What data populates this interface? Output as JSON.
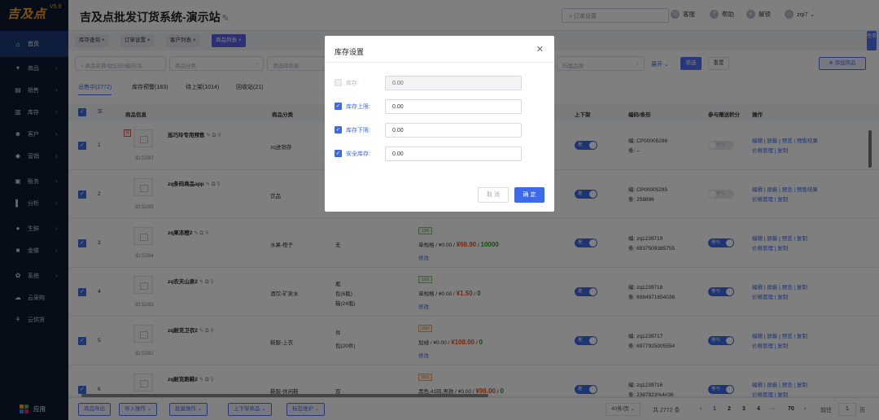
{
  "sidebar": {
    "logo": "吉及点",
    "version": "V5.9",
    "items": [
      {
        "label": "首页",
        "icon": "home-icon",
        "glyph": "⌂"
      },
      {
        "label": "商品",
        "icon": "cart-icon",
        "glyph": "▾"
      },
      {
        "label": "销售",
        "icon": "sales-icon",
        "glyph": "▤"
      },
      {
        "label": "库存",
        "icon": "inventory-icon",
        "glyph": "▥"
      },
      {
        "label": "客户",
        "icon": "customer-icon",
        "glyph": "☻"
      },
      {
        "label": "营销",
        "icon": "marketing-icon",
        "glyph": "◆"
      },
      {
        "label": "账务",
        "icon": "finance-icon",
        "glyph": "▣"
      },
      {
        "label": "分析",
        "icon": "analysis-icon",
        "glyph": "▌"
      },
      {
        "label": "生鲜",
        "icon": "fresh-icon",
        "glyph": "●"
      },
      {
        "label": "金蝶",
        "icon": "kingdee-icon",
        "glyph": "■"
      },
      {
        "label": "系统",
        "icon": "system-icon",
        "glyph": "✿"
      },
      {
        "label": "云采购",
        "icon": "cloud-purchase-icon",
        "glyph": "☁"
      },
      {
        "label": "云供货",
        "icon": "cloud-supply-icon",
        "glyph": "⚘"
      }
    ],
    "app_label": "应用"
  },
  "header": {
    "title": "吉及点批发订货系统-演示站",
    "search_placeholder": "订单设置",
    "service": "客服",
    "help": "帮助",
    "unlock": "解锁",
    "user": "zqi7"
  },
  "tabs": [
    "库存查询",
    "订单设置",
    "客户列表",
    "商品列表"
  ],
  "right_tab": "任务",
  "filters": {
    "keyword_placeholder": "商品名称/助记码/编码/关",
    "category_placeholder": "商品分类",
    "supplier_placeholder": "请选择商家",
    "brand_placeholder": "所属品牌",
    "expand": "展开",
    "filter_btn": "筛选",
    "reset_btn": "重置",
    "add_btn": "添加商品"
  },
  "status_tabs": [
    "出售中(2772)",
    "库存预警(183)",
    "待上架(1014)",
    "回收站(21)"
  ],
  "table": {
    "headers": {
      "info": "商品信息",
      "category": "商品分类",
      "shelf": "上下架",
      "code": "编码/条形",
      "points": "参与赠送积分",
      "ops": "操作"
    },
    "rows": [
      {
        "idx": "1",
        "name": "巡巧玲专用预售",
        "id": "ID:5287",
        "category": "zq进销存",
        "unit": "",
        "spec": "",
        "code": "编: CP00005286",
        "barcode": "条: --",
        "shelf": "是",
        "points": "不参与",
        "ops1": "编辑 | 屏蔽 | 预览 | 预售结果",
        "ops2": "价格管理 | 复制"
      },
      {
        "idx": "2",
        "name": "zq条码商品app",
        "id": "ID:5285",
        "category": "饮品",
        "unit": "",
        "spec": "",
        "code": "编: CP00005285",
        "barcode": "条: 258896",
        "shelf": "是",
        "points": "不参与",
        "ops1": "编辑 | 屏蔽 | 预览 | 预售结果",
        "ops2": "价格管理 | 复制"
      },
      {
        "idx": "3",
        "name": "zq果冻橙2",
        "id": "ID:5284",
        "category": "水果-橙子",
        "unit": "无",
        "stock": "199",
        "spec": "单规格",
        "price0": "¥0.00",
        "price": "¥68.90",
        "qty": "10000",
        "edit": "修改",
        "code": "编: zq1239719",
        "barcode": "条: 6937509385755",
        "shelf": "是",
        "points": "参与",
        "ops1": "编辑 | 屏蔽 | 预览 | 复制",
        "ops2": "价格管理 | 复制"
      },
      {
        "idx": "4",
        "name": "zq农夫山泉2",
        "id": "ID:5283",
        "category": "酒饮-矿泉水",
        "unit": "瓶",
        "unit2": "包(6瓶)",
        "unit3": "箱(24瓶)",
        "stock": "199",
        "spec": "单规格",
        "price0": "¥0.00",
        "price": "¥1.50",
        "qty": "0",
        "edit": "修改",
        "code": "编: zq1239718",
        "barcode": "条: 6984971654036",
        "shelf": "是",
        "points": "参与",
        "ops1": "编辑 | 屏蔽 | 预览 | 复制",
        "ops2": "价格管理 | 复制"
      },
      {
        "idx": "5",
        "name": "zq耐克卫衣2",
        "id": "ID:5282",
        "category": "鞋服-上衣",
        "unit": "件",
        "unit2": "包(20件)",
        "stock": "299",
        "spec": "加绒",
        "price0": "¥0.00",
        "price": "¥108.00",
        "qty": "0",
        "edit": "修改",
        "code": "编: zq1239717",
        "barcode": "条: 6977925005554",
        "shelf": "是",
        "points": "参与",
        "ops1": "编辑 | 屏蔽 | 预览 | 复制",
        "ops2": "价格管理 | 复制"
      },
      {
        "idx": "6",
        "name": "zq耐克跑鞋2",
        "id": "ID:5281",
        "category": "鞋服-休闲鞋",
        "unit": "双",
        "stock": "899",
        "spec": "黑色,41码,男款",
        "price0": "¥0.00",
        "price": "¥98.00",
        "qty": "0",
        "edit": "修改",
        "code": "编: zq1239716",
        "barcode": "条: 2387823%4#36",
        "shelf": "是",
        "points": "参与",
        "ops1": "编辑 | 屏蔽 | 预览 | 复制",
        "ops2": "价格管理 | 复制"
      }
    ]
  },
  "bottom": {
    "buttons": [
      "商品导出",
      "导入操作",
      "批量操作",
      "上下架商品",
      "标签维护"
    ],
    "per_page": "40条/页",
    "total": "共 2772 条",
    "pages": [
      "1",
      "2",
      "3",
      "4",
      "···",
      "70"
    ],
    "goto": "前往",
    "goto_val": "1",
    "page_unit": "页"
  },
  "modal": {
    "title": "库存设置",
    "rows": [
      {
        "label": "库存:",
        "value": "0.00",
        "checked": false
      },
      {
        "label": "库存上限:",
        "value": "0.00",
        "checked": true
      },
      {
        "label": "库存下限:",
        "value": "0.00",
        "checked": true
      },
      {
        "label": "安全库存:",
        "value": "0.00",
        "checked": true
      }
    ],
    "cancel": "取 消",
    "ok": "确 定"
  }
}
